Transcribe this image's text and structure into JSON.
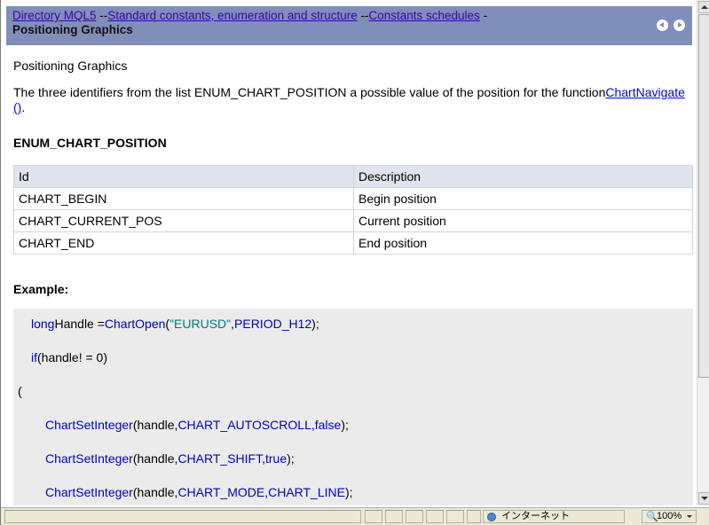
{
  "header": {
    "breadcrumbs": [
      {
        "label": "Directory MQL5"
      },
      {
        "label": "Standard constants, enumeration and structure"
      },
      {
        "label": "Constants schedules"
      }
    ],
    "separators": [
      "--",
      "--",
      "-"
    ],
    "title": "Positioning Graphics",
    "nav": {
      "prev_icon": "prev-circle-icon",
      "next_icon": "next-circle-icon"
    }
  },
  "content": {
    "topic": "Positioning Graphics",
    "intro_text": "The three identifiers from the list ENUM_CHART_POSITION a possible value of the position for the function",
    "intro_link": "ChartNavigate ()",
    "intro_end": ".",
    "enum_heading": "ENUM_CHART_POSITION",
    "table": {
      "headers": [
        "Id",
        "Description"
      ],
      "rows": [
        [
          "CHART_BEGIN",
          "Begin position"
        ],
        [
          "CHART_CURRENT_POS",
          "Current position"
        ],
        [
          "CHART_END",
          "End position"
        ]
      ]
    },
    "example_heading": "Example:",
    "code": {
      "line1": {
        "a": "long",
        "b": "Handle =",
        "c": "ChartOpen",
        "d": "(",
        "e": "\"EURUSD\"",
        "f": ",",
        "g": "PERIOD_H12",
        "h": ");"
      },
      "line2": {
        "a": "if",
        "b": "(handle! = 0)"
      },
      "line3": {
        "a": "("
      },
      "line4": {
        "a": "ChartSetInteger",
        "b": "(handle,",
        "c": "CHART_AUTOSCROLL",
        "d": ",",
        "e": "false",
        "f": ");"
      },
      "line5": {
        "a": "ChartSetInteger",
        "b": "(handle,",
        "c": "CHART_SHIFT",
        "d": ",",
        "e": "true",
        "f": ");"
      },
      "line6": {
        "a": "ChartSetInteger",
        "b": "(handle,",
        "c": "CHART_MODE",
        "d": ",",
        "e": "CHART_LINE",
        "f": ");"
      }
    }
  },
  "statusbar": {
    "zone_label": "インターネット",
    "zoom": "100%"
  },
  "colors": {
    "header_bg": "#7f8fba",
    "link": "#3a00a8",
    "code_keyword": "#0000cc",
    "code_string": "#007d7d",
    "code_bg": "#ebebeb"
  }
}
